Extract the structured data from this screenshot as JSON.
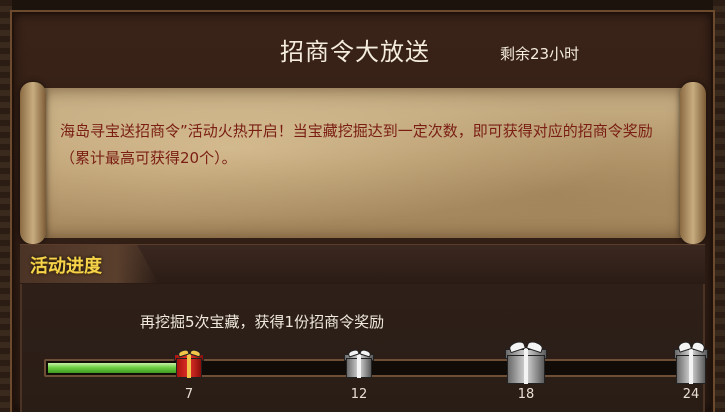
{
  "header": {
    "title": "招商令大放送",
    "time_left": "剩余23小时"
  },
  "notice": {
    "text": "海岛寻宝送招商令”活动火热开启！当宝藏挖掘达到一定次数，即可获得对应的招商令奖励（累计最高可获得20个）。"
  },
  "progress_section": {
    "label": "活动进度",
    "hint": "再挖掘5次宝藏，获得1份招商令奖励",
    "current": 7,
    "max": 24,
    "milestones": [
      {
        "value": "7",
        "gift": "red-gift-icon"
      },
      {
        "value": "12",
        "gift": "gray-gift-icon"
      },
      {
        "value": "18",
        "gift": "gray-gift-icon"
      },
      {
        "value": "24",
        "gift": "gray-gift-icon"
      }
    ]
  },
  "colors": {
    "notice_text": "#7a1e14",
    "section_label": "#f5d44a",
    "progress_fill": "#6fcf44",
    "reached_gift": "#e0322a",
    "locked_gift": "#bfbfbf"
  }
}
